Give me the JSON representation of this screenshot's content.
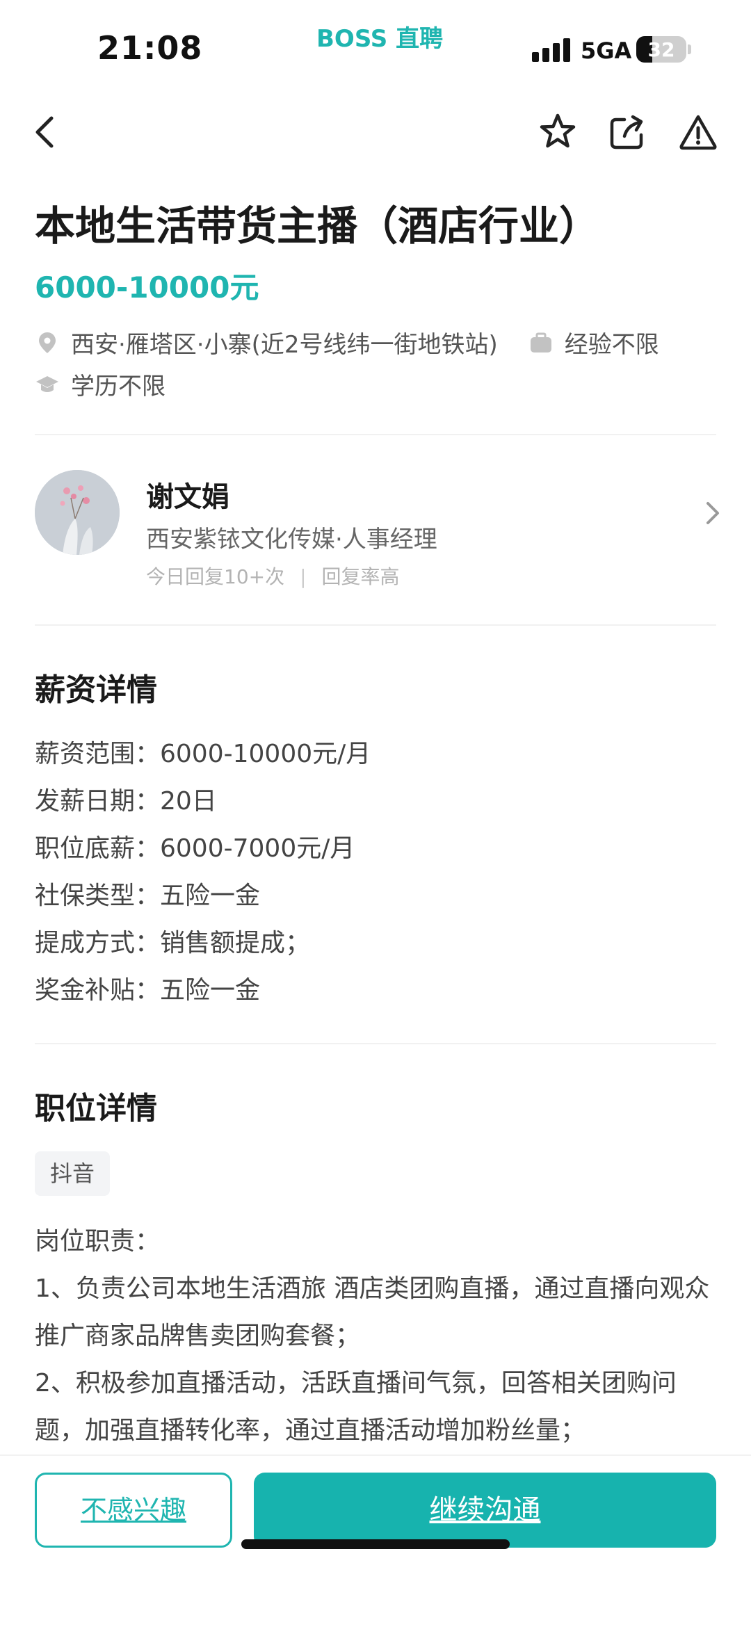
{
  "status_bar": {
    "time": "21:08",
    "app_label": "BOSS 直聘",
    "network": "5GA",
    "battery": "32",
    "battery_level": 0.32
  },
  "nav": {
    "icons": [
      "back-arrow-icon",
      "star-icon",
      "share-icon",
      "warning-icon"
    ]
  },
  "job": {
    "title": "本地生活带货主播（酒店行业）",
    "salary": "6000-10000元",
    "location": "西安·雁塔区·小寨(近2号线纬一街地铁站)",
    "experience": "经验不限",
    "education": "学历不限"
  },
  "recruiter": {
    "name": "谢文娟",
    "company": "西安紫铱文化传媒·人事经理",
    "reply_count": "今日回复10+次",
    "reply_sep": "|",
    "reply_rate": "回复率高"
  },
  "salary_details": {
    "title": "薪资详情",
    "items": [
      "薪资范围：6000-10000元/月",
      "发薪日期：20日",
      "职位底薪：6000-7000元/月",
      "社保类型：五险一金",
      "提成方式：销售额提成；",
      "奖金补贴：五险一金"
    ]
  },
  "job_details": {
    "title": "职位详情",
    "tag": "抖音",
    "description": [
      "岗位职责：",
      "1、负责公司本地生活酒旅 酒店类团购直播，通过直播向观众推广商家品牌售卖团购套餐；",
      "2、积极参加直播活动，活跃直播间气氛，回答相关团购问题，加强直播转化率，通过直播活动增加粉丝量；"
    ]
  },
  "actions": {
    "not_interested": "不感兴趣",
    "continue_chat": "继续沟通"
  },
  "colors": {
    "accent": "#1fb5b0",
    "button": "#17b3ae"
  }
}
